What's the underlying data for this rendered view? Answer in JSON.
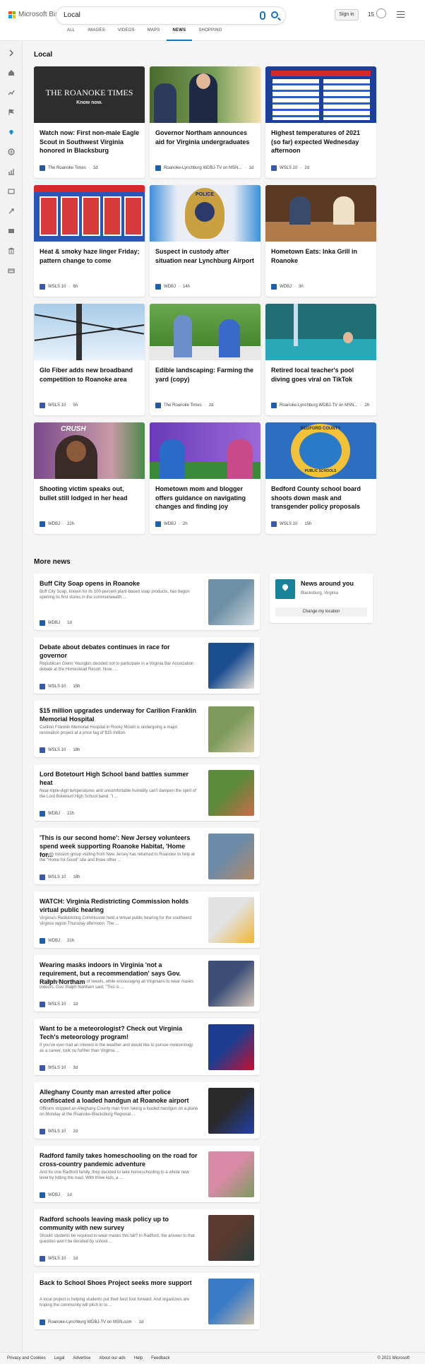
{
  "brand": {
    "name": "Microsoft Bing"
  },
  "search": {
    "query": "Local"
  },
  "header": {
    "signin_label": "Sign in",
    "points": "15"
  },
  "tabs": [
    "ALL",
    "IMAGES",
    "VIDEOS",
    "MAPS",
    "NEWS",
    "SHOPPING"
  ],
  "active_tab": "NEWS",
  "local": {
    "heading": "Local",
    "cards": [
      {
        "title": "Watch now: First non-male Eagle Scout in Southwest Virginia honored in Blacksburg",
        "source": "The Roanoke Times",
        "age": "1d",
        "logo_color": "#2b5797",
        "image_text": "THE ROANOKE TIMES",
        "image_sub": "Know now."
      },
      {
        "title": "Governor Northam announces aid for Virginia undergraduates",
        "source": "Roanoke-Lynchburg WDBJ-TV on MSN...",
        "age": "1d",
        "logo_color": "#1f5fa8"
      },
      {
        "title": "Highest temperatures of 2021 (so far) expected Wednesday afternoon",
        "source": "WSLS 10",
        "age": "2d",
        "logo_color": "#3b5aa6"
      },
      {
        "title": "Heat & smoky haze linger Friday; pattern change to come",
        "source": "WSLS 10",
        "age": "6h",
        "logo_color": "#3b5aa6"
      },
      {
        "title": "Suspect in custody after situation near Lynchburg Airport",
        "source": "WDBJ",
        "age": "14h",
        "logo_color": "#1f5fa8",
        "image_text": "POLICE"
      },
      {
        "title": "Hometown Eats: Inka Grill in Roanoke",
        "source": "WDBJ",
        "age": "3h",
        "logo_color": "#1f5fa8"
      },
      {
        "title": "Glo Fiber adds new broadband competition to Roanoke area",
        "source": "WSLS 10",
        "age": "5h",
        "logo_color": "#3b5aa6"
      },
      {
        "title": "Edible landscaping: Farming the yard (copy)",
        "source": "The Roanoke Times",
        "age": "2d",
        "logo_color": "#2b5797"
      },
      {
        "title": "Retired local teacher's pool diving goes viral on TikTok",
        "source": "Roanoke-Lynchburg WDBJ-TV on MSN...",
        "age": "2h",
        "logo_color": "#1f5fa8"
      },
      {
        "title": "Shooting victim speaks out, bullet still lodged in her head",
        "source": "WDBJ",
        "age": "22h",
        "logo_color": "#1f5fa8",
        "image_text": "CRUSH"
      },
      {
        "title": "Hometown mom and blogger offers guidance on navigating changes and finding joy",
        "source": "WDBJ",
        "age": "2h",
        "logo_color": "#1f5fa8"
      },
      {
        "title": "Bedford County school board shoots down mask and transgender policy proposals",
        "source": "WSLS 10",
        "age": "15h",
        "logo_color": "#3b5aa6",
        "image_text": "BEDFORD COUNTY",
        "image_sub": "PUBLIC SCHOOLS"
      }
    ]
  },
  "more_news": {
    "heading": "More news",
    "items": [
      {
        "title": "Buff City Soap opens in Roanoke",
        "snippet": "Buff City Soap, known for its 100-percent plant-based soap products, has begun opening its first stores in the commonwealth ...",
        "source": "WDBJ",
        "age": "1d",
        "logo_color": "#1f5fa8",
        "thumb": [
          "#6e8fa5",
          "#c9d6dd"
        ]
      },
      {
        "title": "Debate about debates continues in race for governor",
        "snippet": "Republican Glenn Youngkin decided not to participate in a Virginia Bar Association debate at the Homestead Resort. Now, ...",
        "source": "WSLS 10",
        "age": "15h",
        "logo_color": "#3b5aa6",
        "thumb": [
          "#1c4f8f",
          "#e8e1d6"
        ]
      },
      {
        "title": "$15 million upgrades underway for Carilion Franklin Memorial Hospital",
        "snippet": "Carilion Franklin Memorial Hospital in Rocky Mount is undergoing a major renovation project at a price tag of $15 million.",
        "source": "WSLS 10",
        "age": "18h",
        "logo_color": "#3b5aa6",
        "thumb": [
          "#7d9a5a",
          "#d7c9a6"
        ]
      },
      {
        "title": "Lord Botetourt High School band battles summer heat",
        "snippet": "Near-triple-digit temperatures and uncomfortable humidity can't dampen the spirit of the Lord Botetourt High School band. \"I ...",
        "source": "WDBJ",
        "age": "21h",
        "logo_color": "#1f5fa8",
        "thumb": [
          "#5b8a3b",
          "#c96c4a"
        ]
      },
      {
        "title": "'This is our second home': New Jersey volunteers spend week supporting Roanoke Habitat, 'Home for...",
        "snippet": "A youth mission group visiting from New Jersey has returned to Roanoke to help at the \"Home for Good\" site and three other ...",
        "source": "WSLS 10",
        "age": "18h",
        "logo_color": "#3b5aa6",
        "thumb": [
          "#6d8ba8",
          "#b48a66"
        ]
      },
      {
        "title": "WATCH: Virginia Redistricting Commission holds virtual public hearing",
        "snippet": "Virginia's Redistricting Commission held a virtual public hearing for the southwest Virginia region Thursday afternoon. The ...",
        "source": "WDBJ",
        "age": "21h",
        "logo_color": "#1f5fa8",
        "thumb": [
          "#e2e2e2",
          "#f2b632"
        ]
      },
      {
        "title": "Wearing masks indoors in Virginia 'not a requirement, but a recommendation' says Gov. Ralph Northam",
        "snippet": "On Thursday, in a series of tweets, while encouraging all Virginians to wear masks indoors, Gov. Ralph Northam said, \"This is ...",
        "source": "WSLS 10",
        "age": "1d",
        "logo_color": "#3b5aa6",
        "thumb": [
          "#3d4f77",
          "#d6c7b8"
        ]
      },
      {
        "title": "Want to be a meteorologist? Check out Virginia Tech's meteorology program!",
        "snippet": "If you've ever had an interest in the weather and would like to pursue meteorology as a career, look no further than Virginia ...",
        "source": "WSLS 10",
        "age": "3d",
        "logo_color": "#3b5aa6",
        "thumb": [
          "#1d3c8f",
          "#c8102e"
        ]
      },
      {
        "title": "Alleghany County man arrested after police confiscated a loaded handgun at Roanoke airport",
        "snippet": "Officers stopped an Alleghany County man from taking a loaded handgun on a plane on Monday at the Roanoke-Blacksburg Regional ...",
        "source": "WSLS 10",
        "age": "2d",
        "logo_color": "#3b5aa6",
        "thumb": [
          "#2a2a2a",
          "#2340a8"
        ]
      },
      {
        "title": "Radford family takes homeschooling on the road for cross-country pandemic adventure",
        "snippet": "And for one Radford family, they decided to take homeschooling to a whole new level by hitting the road. With three kids, a ...",
        "source": "WDBJ",
        "age": "1d",
        "logo_color": "#1f5fa8",
        "thumb": [
          "#d98aa6",
          "#7a9c5f"
        ]
      },
      {
        "title": "Radford schools leaving mask policy up to community with new survey",
        "snippet": "Should students be required to wear masks this fall? In Radford, the answer to that question won't be decided by school ...",
        "source": "WSLS 10",
        "age": "1d",
        "logo_color": "#3b5aa6",
        "thumb": [
          "#5a3a2e",
          "#2c3e3f"
        ]
      },
      {
        "title": "Back to School Shoes Project seeks more support",
        "snippet": "A local project is helping students put their best foot forward. And organizers are hoping the community will pitch in to ...",
        "source": "Roanoke-Lynchburg WDBJ-TV on MSN.com",
        "age": "1d",
        "logo_color": "#1f5fa8",
        "thumb": [
          "#3a7bc8",
          "#c8b8a0"
        ]
      }
    ]
  },
  "news_around": {
    "title": "News around you",
    "location": "Blacksburg, Virginia",
    "button": "Change my location"
  },
  "footer": {
    "links": [
      "Privacy and Cookies",
      "Legal",
      "Advertise",
      "About our ads",
      "Help",
      "Feedback"
    ],
    "copyright": "© 2021 Microsoft"
  }
}
